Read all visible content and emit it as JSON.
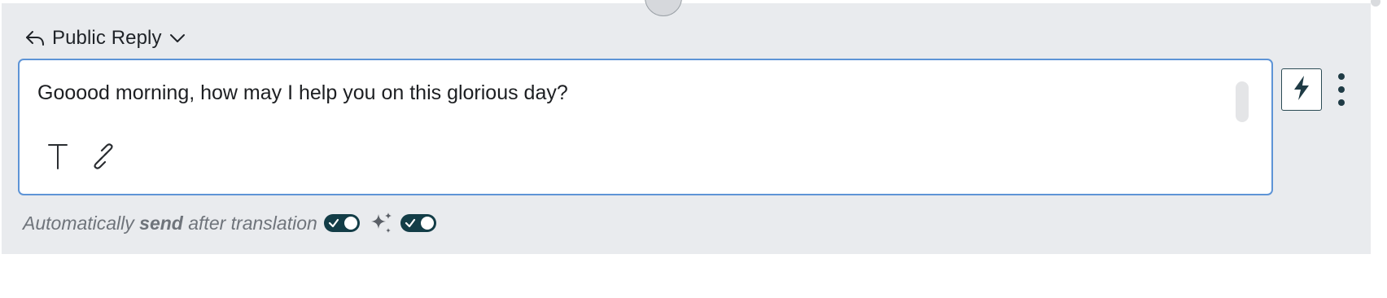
{
  "reply_mode": {
    "label": "Public Reply",
    "icon": "reply-arrow-icon",
    "dropdown_icon": "chevron-down-icon"
  },
  "editor": {
    "content": "Gooood morning, how may I help you on this glorious day?",
    "toolbar": [
      {
        "name": "text-format-icon"
      },
      {
        "name": "link-icon"
      }
    ]
  },
  "side_actions": {
    "macro_icon": "lightning-bolt-icon",
    "more_icon": "vertical-ellipsis-icon"
  },
  "footer": {
    "prefix": "Automatically",
    "emphasis": "send",
    "suffix": "after translation",
    "send_toggle_on": true,
    "ai_icon": "sparkle-icon",
    "ai_toggle_on": true
  },
  "colors": {
    "panel_bg": "#e9ebee",
    "editor_border": "#5e94d6",
    "toggle_on": "#133d47",
    "icon_dark": "#1f3b45"
  }
}
